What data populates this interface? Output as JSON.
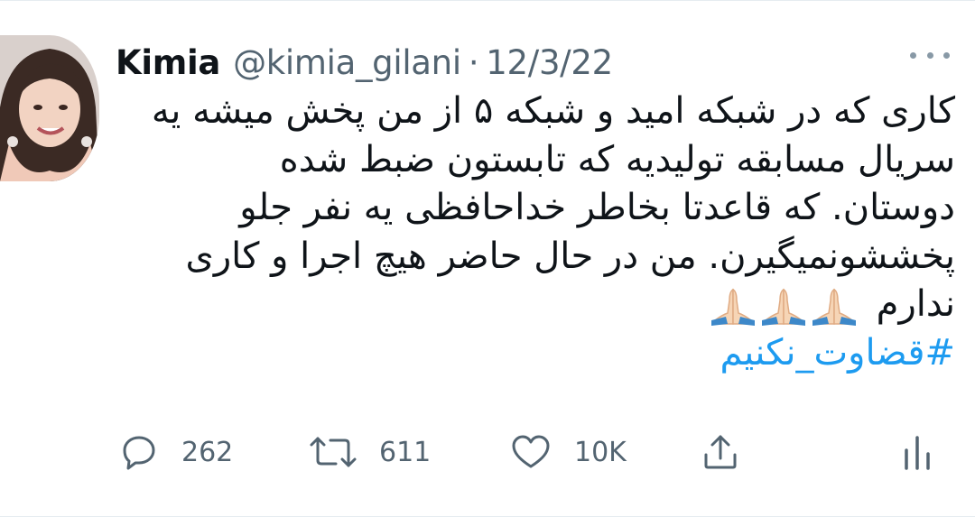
{
  "tweet": {
    "display_name": "Kimia",
    "handle": "@kimia_gilani",
    "separator": "·",
    "date": "12/3/22",
    "lines": [
      "کاری که در شبکه امید و شبکه ۵ از من پخش میشه یه",
      "سریال مسابقه تولیدیه که تابستون ضبط شده",
      "دوستان. که قاعدتا بخاطر خداحافظی یه نفر جلو",
      "پخششونمیگیرن. من در حال حاضر هیچ اجرا و کاری",
      "ندارم"
    ],
    "emojis": [
      "🙏🏻",
      "🙏🏻",
      "🙏🏻"
    ],
    "hashtag": "#قضاوت_نکنیم"
  },
  "actions": {
    "reply_count": "262",
    "retweet_count": "611",
    "like_count": "10K"
  },
  "colors": {
    "text": "#0f1419",
    "secondary": "#536471",
    "link": "#1d9bf0"
  },
  "icons": [
    "more-icon",
    "reply-icon",
    "retweet-icon",
    "like-icon",
    "share-icon",
    "analytics-icon",
    "folded-hands-icon"
  ]
}
